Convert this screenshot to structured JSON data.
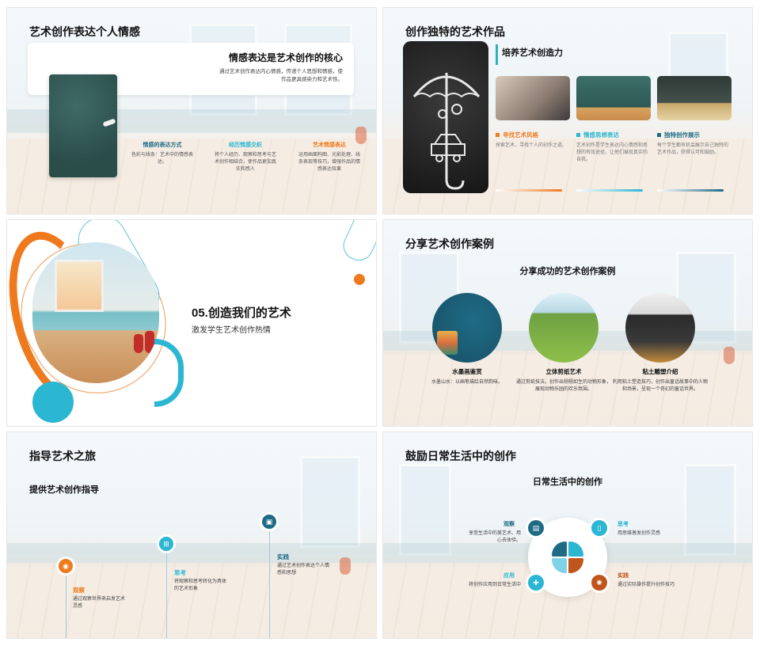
{
  "colors": {
    "orange": "#ef7a1e",
    "teal": "#2bb6d2",
    "navy": "#1f6b86",
    "rust": "#c0551c"
  },
  "slide1": {
    "title": "艺术创作表达个人情感",
    "card_title": "情感表达是艺术创作的核心",
    "card_desc": "通过艺术创作表达内心情感，传递个人思想和情感，使作品更具感染力和艺术性。",
    "columns": [
      {
        "heading": "情感的表达方式",
        "text": "色彩与线条：艺术中的情感表达。",
        "color": "#1f6b86"
      },
      {
        "heading": "经历情感交织",
        "text": "将个人经历、观察和思考与艺术创作相结合，使作品更加真实和感人",
        "color": "#2bb6d2"
      },
      {
        "heading": "艺术情感表达",
        "text": "运用画面构图、光影处理、线条表现等技巧，增强作品的情感表达效果",
        "color": "#ef7a1e"
      }
    ]
  },
  "slide2": {
    "title": "创作独特的艺术作品",
    "subtitle": "培养艺术创造力",
    "features": [
      {
        "heading": "寻找艺术风格",
        "text": "探索艺术，寻找个人的创作之道。",
        "color": "#ef7a1e"
      },
      {
        "heading": "情感思想表达",
        "text": "艺术创作是学生表达内心情感和思想的有效途径，让他们展现真实的自我。",
        "color": "#2bb6d2"
      },
      {
        "heading": "独特创作展示",
        "text": "每个学生都有机会展示自己独特的艺术作品，获得认可和鼓励。",
        "color": "#1f6b86"
      }
    ]
  },
  "slide3": {
    "title": "05.创造我们的艺术",
    "subtitle": "激发学生艺术创作热情"
  },
  "slide4": {
    "title": "分享艺术创作案例",
    "subtitle": "分享成功的艺术创作案例",
    "cases": [
      {
        "heading": "水墨画鉴赏",
        "text": "水墨山水：以画笔描绘自然韵味。"
      },
      {
        "heading": "立体剪纸艺术",
        "text": "通过剪纸技法，创作出栩栩如生的动物形象，展现动物乐园的欢乐氛围。"
      },
      {
        "heading": "粘土雕塑介绍",
        "text": "利用粘土塑造技巧，创作出童话故事中的人物和场景，呈现一个奇幻的童话世界。"
      }
    ]
  },
  "slide5": {
    "title": "指导艺术之旅",
    "subtitle": "提供艺术创作指导",
    "steps": [
      {
        "heading": "观察",
        "text": "通过观察世界来启发艺术灵感",
        "color": "#ef7a1e",
        "icon": "eye-icon"
      },
      {
        "heading": "思考",
        "text": "将观察和思考转化为具体的艺术形象",
        "color": "#2bb6d2",
        "icon": "network-icon"
      },
      {
        "heading": "实践",
        "text": "通过艺术创作表达个人情感和思想",
        "color": "#1f6b86",
        "icon": "image-icon"
      }
    ]
  },
  "slide6": {
    "title": "鼓励日常生活中的创作",
    "subtitle": "日常生活中的创作",
    "items": [
      {
        "heading": "观察",
        "text": "享受生活中的美艺术、用心去体验。",
        "color": "#1f6b86",
        "icon": "briefcase-icon"
      },
      {
        "heading": "思考",
        "text": "用思维激发创作灵感",
        "color": "#2bb6d2",
        "icon": "document-icon"
      },
      {
        "heading": "应用",
        "text": "将创作应用到日常生活中",
        "color": "#2bb6d2",
        "icon": "tools-icon"
      },
      {
        "heading": "实践",
        "text": "通过实际操作提升创作技巧",
        "color": "#c0551c",
        "icon": "gear-icon"
      }
    ]
  }
}
